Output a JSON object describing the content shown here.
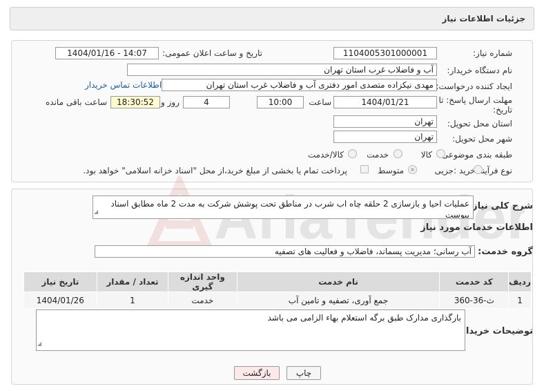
{
  "header": {
    "title": "جزئیات اطلاعات نیاز"
  },
  "form": {
    "need_number_label": "شماره نیاز:",
    "need_number": "1104005301000001",
    "announce_label": "تاریخ و ساعت اعلان عمومی:",
    "announce_value": "1404/01/16 - 14:07",
    "buyer_org_label": "نام دستگاه خریدار:",
    "buyer_org": "آب و فاضلاب غرب استان تهران",
    "creator_label": "ایجاد کننده درخواست:",
    "creator": "مهدی نیکزاده متصدی امور دفتری آب و فاضلاب غرب استان تهران",
    "contact_link": "اطلاعات تماس خریدار",
    "deadline_label": "مهلت ارسال پاسخ: تا تاریخ:",
    "deadline_date": "1404/01/21",
    "time_label": "ساعت",
    "deadline_time": "10:00",
    "days_value": "4",
    "days_label": "روز و",
    "remaining_time": "18:30:52",
    "remaining_label": "ساعت باقی مانده",
    "province_label": "استان محل تحویل:",
    "province": "تهران",
    "city_label": "شهر محل تحویل:",
    "city": "تهران",
    "category_label": "طبقه بندی موضوعی:",
    "category_options": [
      "کالا",
      "خدمت",
      "کالا/خدمت"
    ],
    "category_selected": "خدمت",
    "process_label": "نوع فرآیند خرید :",
    "process_options": [
      "جزیی",
      "متوسط"
    ],
    "process_selected": "متوسط",
    "payment_note": "پرداخت تمام یا بخشی از مبلغ خرید،از محل \"اسناد خزانه اسلامی\" خواهد بود."
  },
  "summary": {
    "label": "شرح کلی نیاز:",
    "text": "عملیات احیا و بازسازی 2 حلقه چاه اب شرب در مناطق تحت پوشش شرکت به مدت 2 ماه مطابق اسناد پیوست",
    "services_heading": "اطلاعات خدمات مورد نیاز",
    "group_label": "گروه خدمت:",
    "group_value": "آب رسانی؛ مدیریت پسماند، فاضلاب و فعالیت های تصفیه"
  },
  "table": {
    "headers": [
      "ردیف",
      "کد خدمت",
      "نام خدمت",
      "واحد اندازه گیری",
      "تعداد / مقدار",
      "تاریخ نیاز"
    ],
    "rows": [
      [
        "1",
        "ث-36-360",
        "جمع آوری، تصفیه و تامین آب",
        "خدمت",
        "1",
        "1404/01/26"
      ]
    ]
  },
  "notes": {
    "label": "توضیحات خریدار:",
    "text": "بارگذاری مدارک طبق برگه استعلام بهاء الزامی می باشد"
  },
  "buttons": {
    "print": "چاپ",
    "back": "بازگشت"
  },
  "watermark": {
    "text": "AriaTender.neT"
  },
  "colors": {
    "link": "#1a5fb4",
    "back_button_bg": "#fde8ea",
    "remaining_bg": "#fffbd0"
  }
}
